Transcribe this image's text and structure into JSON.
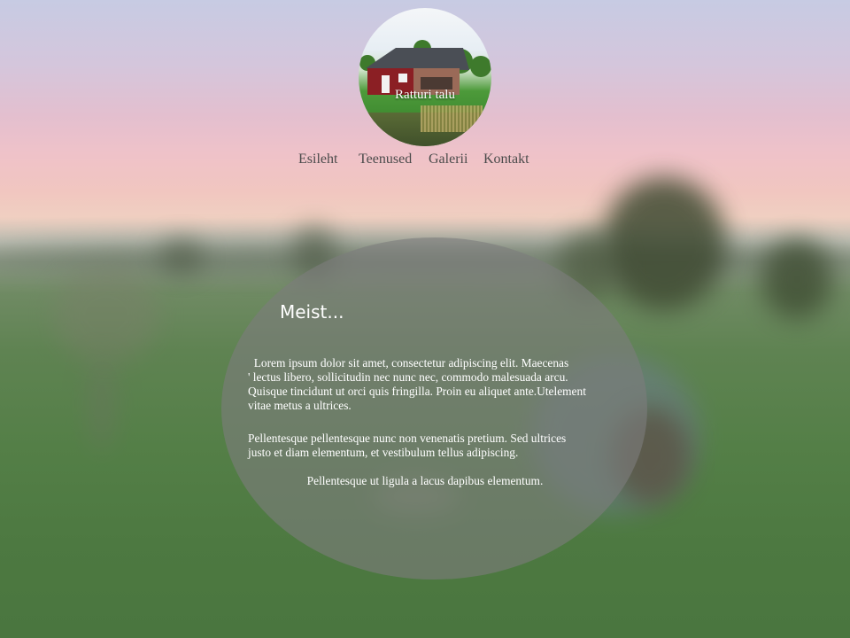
{
  "site": {
    "title": "Ratturi talu"
  },
  "nav": {
    "items": [
      {
        "label": "Esileht"
      },
      {
        "label": "Teenused"
      },
      {
        "label": "Galerii"
      },
      {
        "label": "Kontakt"
      }
    ]
  },
  "content": {
    "heading": "Meist...",
    "paragraph1": [
      "  Lorem ipsum dolor sit amet, consectetur adipiscing elit. Maecenas",
      "' lectus libero, sollicitudin nec nunc nec, commodo malesuada arcu.",
      "Quisque tincidunt ut orci quis fringilla. Proin eu aliquet ante.Utelement",
      "vitae metus a ultrices."
    ],
    "paragraph2": [
      "Pellentesque pellentesque nunc non venenatis pretium. Sed ultrices",
      "justo et diam elementum, et vestibulum tellus adipiscing."
    ],
    "paragraph3": "Pellentesque ut ligula a lacus dapibus elementum."
  },
  "colors": {
    "nav_text": "#4b4b4b",
    "panel_fill": "#7d7d7d",
    "panel_text": "#ffffff"
  }
}
